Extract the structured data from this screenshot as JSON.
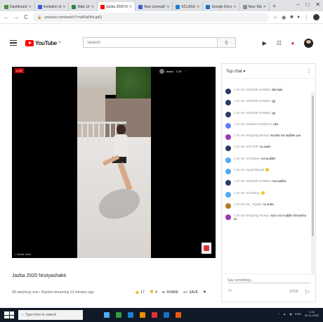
{
  "browser": {
    "tabs": [
      {
        "label": "Dashboard",
        "color": "#4a8f3c",
        "active": false
      },
      {
        "label": "Invitation of",
        "color": "#3b5bdb",
        "active": false
      },
      {
        "label": "Main UI",
        "color": "#2b8a3e",
        "active": false
      },
      {
        "label": "Jazba 2020 N",
        "color": "#ff0000",
        "active": true
      },
      {
        "label": "New (unread)",
        "color": "#3b5bdb",
        "active": false
      },
      {
        "label": "ECLASS",
        "color": "#1c7ed6",
        "active": false
      },
      {
        "label": "Google Docs",
        "color": "#1971c2",
        "active": false
      },
      {
        "label": "New Tab",
        "color": "#868e96",
        "active": false
      }
    ],
    "new_tab": "+",
    "window_controls": [
      "−",
      "□",
      "✕"
    ],
    "url": "youtube.com/watch?v=jANaNhiLgdQ",
    "back": "←",
    "forward": "→",
    "reload": "C"
  },
  "youtube": {
    "logo_word": "YouTube",
    "logo_region": "IN",
    "search_placeholder": "Search"
  },
  "player": {
    "live_badge": "LIVE",
    "overlay_channel": "Jazba",
    "overlay_count": "1.2K",
    "overlay_menu": "⋮",
    "corner_text": "• Jazba Zone"
  },
  "video": {
    "title": "Jazba 2020 Nrutyashakti",
    "meta": "58 watching now • Started streaming 13 minutes ago",
    "likes": "17",
    "dislikes": "4",
    "share": "SHARE",
    "save": "SAVE",
    "more": "⚑"
  },
  "chat": {
    "header": "Top chat ▾",
    "menu": "⋮",
    "messages": [
      {
        "time": "1:30 AM",
        "name": "HUNTER SAMINU",
        "text": "Bla bala",
        "avatar_color": "#2b3a67"
      },
      {
        "time": "1:30 AM",
        "name": "HUNTER SAMINU",
        "text": "gg",
        "avatar_color": "#2b3a67"
      },
      {
        "time": "1:30 AM",
        "name": "HUNTER SAMINU",
        "text": "gg",
        "avatar_color": "#2b3a67"
      },
      {
        "time": "1:30 AM",
        "name": "Siddhant Shukla 03",
        "text": "Like",
        "avatar_color": "#5c7cfa"
      },
      {
        "time": "1:30 AM",
        "name": "Nrutyshaj Parmar",
        "text": "sounds not audible yaa",
        "avatar_color": "#9c36b5"
      },
      {
        "time": "1:30 AM",
        "name": "HIP HOP",
        "text": "no audio",
        "avatar_color": "#2b3a67"
      },
      {
        "time": "1:30 AM",
        "name": "Arti Dubey",
        "text": "not audible",
        "avatar_color": "#4dabf7"
      },
      {
        "time": "1:30 AM",
        "name": "Ayush Bhuval",
        "text": "",
        "emoji": true,
        "avatar_color": "#4dabf7"
      },
      {
        "time": "1:30 AM",
        "name": "HUNTER SAMINU",
        "text": "not audible",
        "avatar_color": "#2b3a67"
      },
      {
        "time": "1:30 AM",
        "name": "Arti Dubey",
        "text": "",
        "emoji": true,
        "avatar_color": "#4dabf7"
      },
      {
        "time": "1:30 AM",
        "name": "Mr_ Yogitas",
        "text": "no audio",
        "avatar_color": "#b7791f"
      },
      {
        "time": "1:30 AM",
        "name": "Nrutyshaj Parmar",
        "text": "voice not Audible himanshu sir",
        "avatar_color": "#9c36b5"
      }
    ],
    "input_placeholder": "Say something...",
    "char_count": "0/200",
    "send": "▷",
    "emoji_btn": "☺"
  },
  "taskbar": {
    "search_text": "Type here to search",
    "clock_time": "1:34",
    "clock_date": "20-11-2020",
    "lang": "ENG",
    "apps": [
      "#4dabf7",
      "#2f9e44",
      "#1c7ed6",
      "#f08c00",
      "#e03131",
      "#1971c2",
      "#e8590c"
    ]
  }
}
